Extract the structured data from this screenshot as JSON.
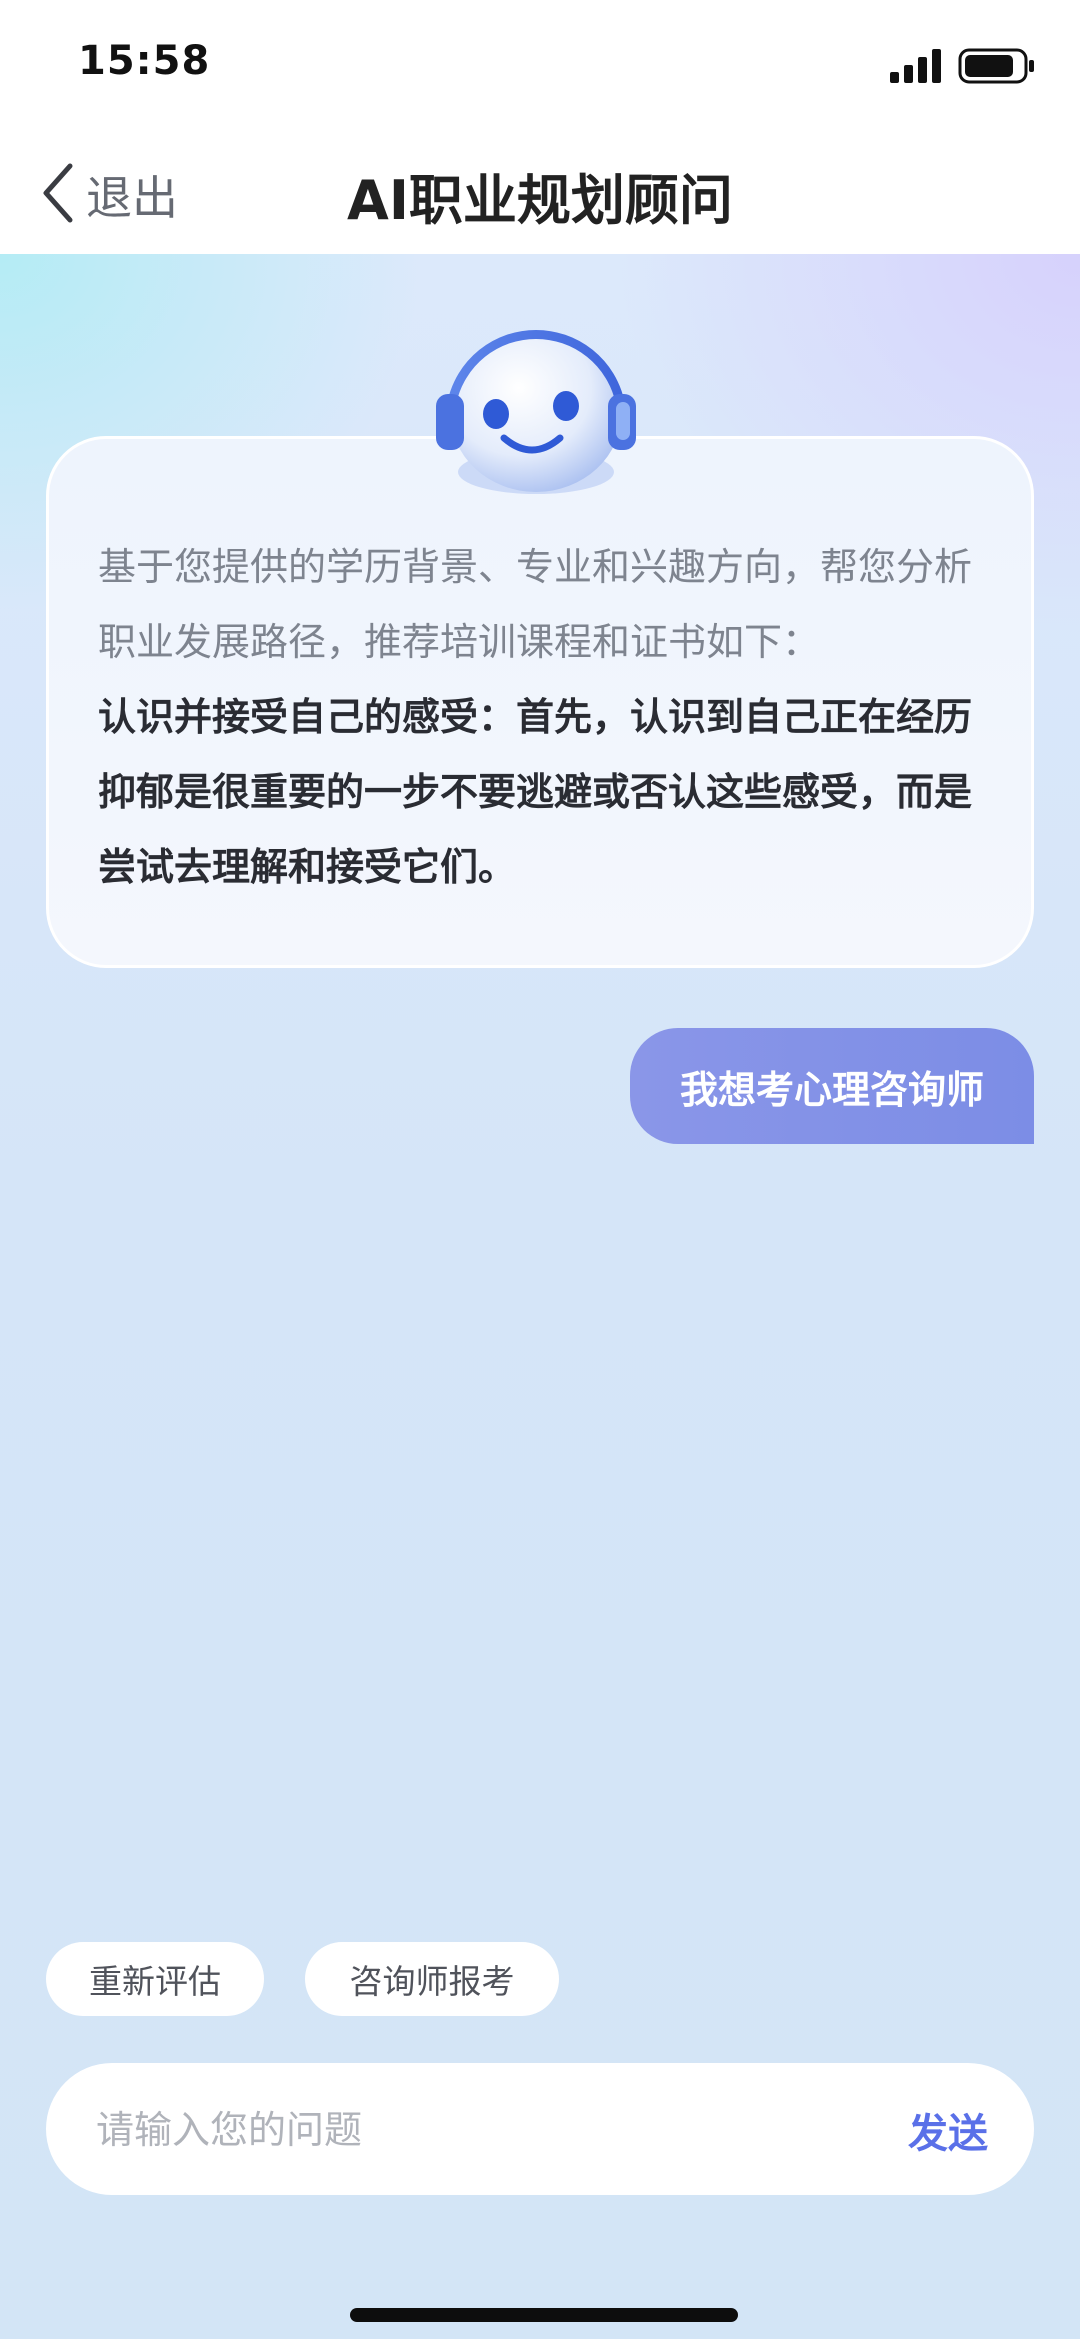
{
  "status_bar": {
    "time": "15:58",
    "signal_icon": "cellular-signal-icon",
    "battery_icon": "battery-icon"
  },
  "nav": {
    "back_label": "退出",
    "back_icon": "chevron-left-icon",
    "title": "AI职业规划顾问"
  },
  "conversation": {
    "bot_avatar_icon": "robot-headset-avatar-icon",
    "bot_message_intro": "基于您提供的学历背景、专业和兴趣方向，帮您分析职业发展路径，推荐培训课程和证书如下：",
    "bot_message_body": "认识并接受自己的感受：首先，认识到自己正在经历抑郁是很重要的一步不要逃避或否认这些感受，而是尝试去理解和接受它们。",
    "user_message": "我想考心理咨询师"
  },
  "quick_actions": [
    {
      "label": "重新评估"
    },
    {
      "label": "咨询师报考"
    }
  ],
  "composer": {
    "placeholder": "请输入您的问题",
    "send_label": "发送"
  },
  "colors": {
    "accent": "#5a70e8",
    "user_bubble": "#8390e7",
    "title_text": "#222222"
  }
}
